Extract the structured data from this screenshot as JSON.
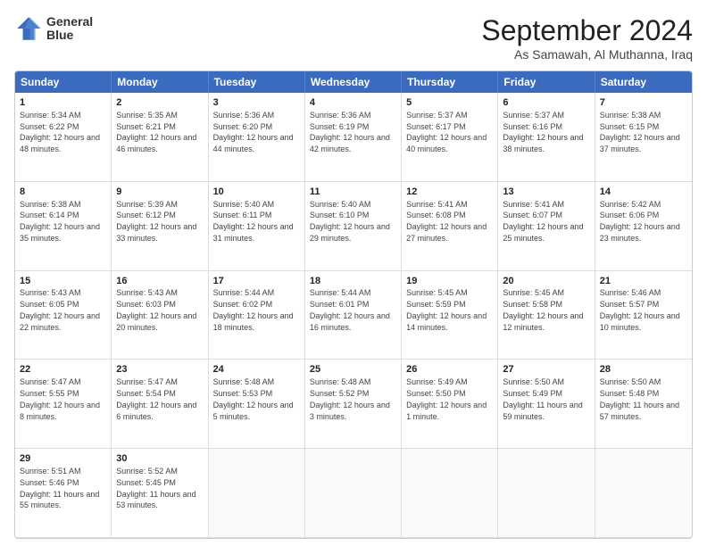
{
  "header": {
    "logo_line1": "General",
    "logo_line2": "Blue",
    "month_title": "September 2024",
    "location": "As Samawah, Al Muthanna, Iraq"
  },
  "days_of_week": [
    "Sunday",
    "Monday",
    "Tuesday",
    "Wednesday",
    "Thursday",
    "Friday",
    "Saturday"
  ],
  "cells": [
    {
      "day": "",
      "empty": true
    },
    {
      "day": "",
      "empty": true
    },
    {
      "day": "",
      "empty": true
    },
    {
      "day": "",
      "empty": true
    },
    {
      "day": "",
      "empty": true
    },
    {
      "day": "",
      "empty": true
    },
    {
      "day": "",
      "empty": true
    },
    {
      "day": "1",
      "sunrise": "Sunrise: 5:34 AM",
      "sunset": "Sunset: 6:22 PM",
      "daylight": "Daylight: 12 hours and 48 minutes."
    },
    {
      "day": "2",
      "sunrise": "Sunrise: 5:35 AM",
      "sunset": "Sunset: 6:21 PM",
      "daylight": "Daylight: 12 hours and 46 minutes."
    },
    {
      "day": "3",
      "sunrise": "Sunrise: 5:36 AM",
      "sunset": "Sunset: 6:20 PM",
      "daylight": "Daylight: 12 hours and 44 minutes."
    },
    {
      "day": "4",
      "sunrise": "Sunrise: 5:36 AM",
      "sunset": "Sunset: 6:19 PM",
      "daylight": "Daylight: 12 hours and 42 minutes."
    },
    {
      "day": "5",
      "sunrise": "Sunrise: 5:37 AM",
      "sunset": "Sunset: 6:17 PM",
      "daylight": "Daylight: 12 hours and 40 minutes."
    },
    {
      "day": "6",
      "sunrise": "Sunrise: 5:37 AM",
      "sunset": "Sunset: 6:16 PM",
      "daylight": "Daylight: 12 hours and 38 minutes."
    },
    {
      "day": "7",
      "sunrise": "Sunrise: 5:38 AM",
      "sunset": "Sunset: 6:15 PM",
      "daylight": "Daylight: 12 hours and 37 minutes."
    },
    {
      "day": "8",
      "sunrise": "Sunrise: 5:38 AM",
      "sunset": "Sunset: 6:14 PM",
      "daylight": "Daylight: 12 hours and 35 minutes."
    },
    {
      "day": "9",
      "sunrise": "Sunrise: 5:39 AM",
      "sunset": "Sunset: 6:12 PM",
      "daylight": "Daylight: 12 hours and 33 minutes."
    },
    {
      "day": "10",
      "sunrise": "Sunrise: 5:40 AM",
      "sunset": "Sunset: 6:11 PM",
      "daylight": "Daylight: 12 hours and 31 minutes."
    },
    {
      "day": "11",
      "sunrise": "Sunrise: 5:40 AM",
      "sunset": "Sunset: 6:10 PM",
      "daylight": "Daylight: 12 hours and 29 minutes."
    },
    {
      "day": "12",
      "sunrise": "Sunrise: 5:41 AM",
      "sunset": "Sunset: 6:08 PM",
      "daylight": "Daylight: 12 hours and 27 minutes."
    },
    {
      "day": "13",
      "sunrise": "Sunrise: 5:41 AM",
      "sunset": "Sunset: 6:07 PM",
      "daylight": "Daylight: 12 hours and 25 minutes."
    },
    {
      "day": "14",
      "sunrise": "Sunrise: 5:42 AM",
      "sunset": "Sunset: 6:06 PM",
      "daylight": "Daylight: 12 hours and 23 minutes."
    },
    {
      "day": "15",
      "sunrise": "Sunrise: 5:43 AM",
      "sunset": "Sunset: 6:05 PM",
      "daylight": "Daylight: 12 hours and 22 minutes."
    },
    {
      "day": "16",
      "sunrise": "Sunrise: 5:43 AM",
      "sunset": "Sunset: 6:03 PM",
      "daylight": "Daylight: 12 hours and 20 minutes."
    },
    {
      "day": "17",
      "sunrise": "Sunrise: 5:44 AM",
      "sunset": "Sunset: 6:02 PM",
      "daylight": "Daylight: 12 hours and 18 minutes."
    },
    {
      "day": "18",
      "sunrise": "Sunrise: 5:44 AM",
      "sunset": "Sunset: 6:01 PM",
      "daylight": "Daylight: 12 hours and 16 minutes."
    },
    {
      "day": "19",
      "sunrise": "Sunrise: 5:45 AM",
      "sunset": "Sunset: 5:59 PM",
      "daylight": "Daylight: 12 hours and 14 minutes."
    },
    {
      "day": "20",
      "sunrise": "Sunrise: 5:45 AM",
      "sunset": "Sunset: 5:58 PM",
      "daylight": "Daylight: 12 hours and 12 minutes."
    },
    {
      "day": "21",
      "sunrise": "Sunrise: 5:46 AM",
      "sunset": "Sunset: 5:57 PM",
      "daylight": "Daylight: 12 hours and 10 minutes."
    },
    {
      "day": "22",
      "sunrise": "Sunrise: 5:47 AM",
      "sunset": "Sunset: 5:55 PM",
      "daylight": "Daylight: 12 hours and 8 minutes."
    },
    {
      "day": "23",
      "sunrise": "Sunrise: 5:47 AM",
      "sunset": "Sunset: 5:54 PM",
      "daylight": "Daylight: 12 hours and 6 minutes."
    },
    {
      "day": "24",
      "sunrise": "Sunrise: 5:48 AM",
      "sunset": "Sunset: 5:53 PM",
      "daylight": "Daylight: 12 hours and 5 minutes."
    },
    {
      "day": "25",
      "sunrise": "Sunrise: 5:48 AM",
      "sunset": "Sunset: 5:52 PM",
      "daylight": "Daylight: 12 hours and 3 minutes."
    },
    {
      "day": "26",
      "sunrise": "Sunrise: 5:49 AM",
      "sunset": "Sunset: 5:50 PM",
      "daylight": "Daylight: 12 hours and 1 minute."
    },
    {
      "day": "27",
      "sunrise": "Sunrise: 5:50 AM",
      "sunset": "Sunset: 5:49 PM",
      "daylight": "Daylight: 11 hours and 59 minutes."
    },
    {
      "day": "28",
      "sunrise": "Sunrise: 5:50 AM",
      "sunset": "Sunset: 5:48 PM",
      "daylight": "Daylight: 11 hours and 57 minutes."
    },
    {
      "day": "29",
      "sunrise": "Sunrise: 5:51 AM",
      "sunset": "Sunset: 5:46 PM",
      "daylight": "Daylight: 11 hours and 55 minutes."
    },
    {
      "day": "30",
      "sunrise": "Sunrise: 5:52 AM",
      "sunset": "Sunset: 5:45 PM",
      "daylight": "Daylight: 11 hours and 53 minutes."
    },
    {
      "day": "",
      "empty": true
    },
    {
      "day": "",
      "empty": true
    },
    {
      "day": "",
      "empty": true
    },
    {
      "day": "",
      "empty": true
    },
    {
      "day": "",
      "empty": true
    }
  ]
}
